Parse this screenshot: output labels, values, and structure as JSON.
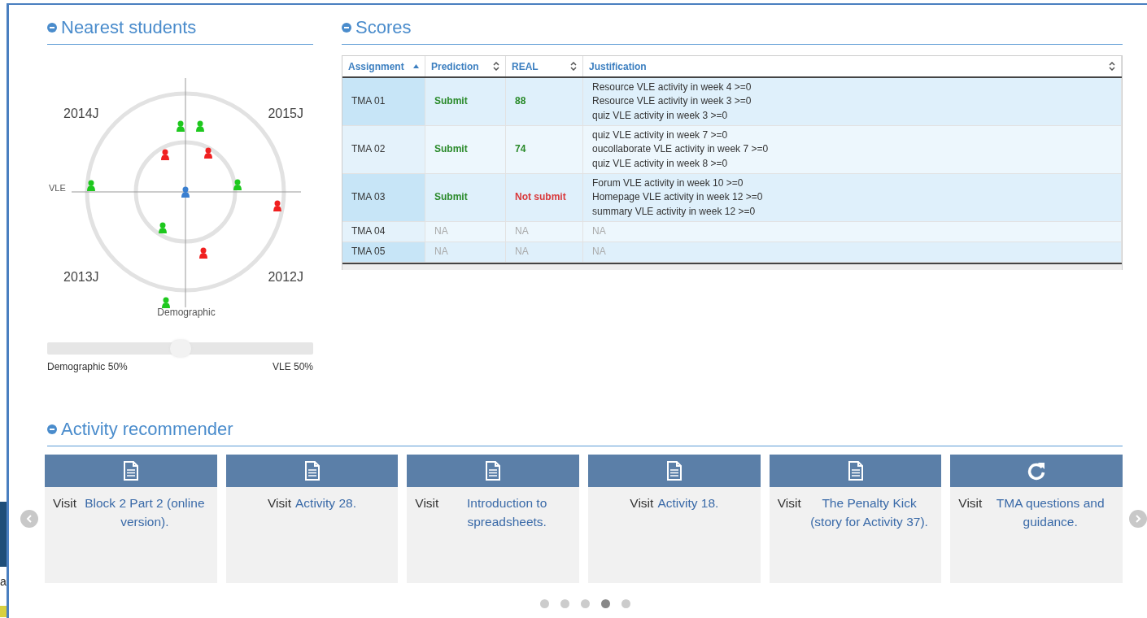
{
  "behind_window": {
    "text": "a"
  },
  "nearest_students": {
    "title": "Nearest students",
    "quadrants": [
      "2014J",
      "2015J",
      "2013J",
      "2012J"
    ],
    "students": [
      {
        "color": "#1ec81e"
      },
      {
        "color": "#1ec81e"
      },
      {
        "color": "#f02020"
      },
      {
        "color": "#f02020"
      },
      {
        "color": "#1ec81e"
      },
      {
        "color": "#1ec81e"
      },
      {
        "color": "#3a7fd0"
      },
      {
        "color": "#f02020"
      },
      {
        "color": "#1ec81e"
      },
      {
        "color": "#f02020"
      },
      {
        "color": "#1ec81e"
      }
    ],
    "x_axis_label": "VLE",
    "y_axis_label": "Demographic",
    "weight_slider": {
      "level": 0.5,
      "left_label": "Demographic 50%",
      "right_label": "VLE 50%"
    }
  },
  "scores": {
    "title": "Scores",
    "columns": [
      {
        "label": "Assignment",
        "kind": "sorted"
      },
      {
        "label": "Prediction",
        "kind": "sortable"
      },
      {
        "label": "REAL",
        "kind": "sortable"
      },
      {
        "label": "Justification",
        "kind": "sortable"
      }
    ],
    "rows": [
      {
        "assignment": "TMA 01",
        "prediction": {
          "text": "Submit",
          "kind": "positive"
        },
        "real": {
          "text": "88",
          "kind": "positive"
        },
        "justification": {
          "kind": "rules",
          "lines": [
            "Resource VLE activity in week 4 >=0",
            "Resource VLE activity in week 3 >=0",
            "quiz VLE activity in week 3 >=0"
          ]
        }
      },
      {
        "assignment": "TMA 02",
        "prediction": {
          "text": "Submit",
          "kind": "positive"
        },
        "real": {
          "text": "74",
          "kind": "positive"
        },
        "justification": {
          "kind": "rules",
          "lines": [
            "quiz VLE activity in week 7 >=0",
            "oucollaborate VLE activity in week 7 >=0",
            "quiz VLE activity in week 8 >=0"
          ]
        }
      },
      {
        "assignment": "TMA 03",
        "prediction": {
          "text": "Submit",
          "kind": "positive"
        },
        "real": {
          "text": "Not submit",
          "kind": "negative"
        },
        "justification": {
          "kind": "rules",
          "lines": [
            "Forum VLE activity in week 10 >=0",
            "Homepage VLE activity in week 12 >=0",
            "summary VLE activity in week 12 >=0"
          ]
        }
      },
      {
        "assignment": "TMA 04",
        "prediction": {
          "text": "NA",
          "kind": "na"
        },
        "real": {
          "text": "NA",
          "kind": "na"
        },
        "justification": {
          "kind": "na",
          "lines": [
            "NA"
          ]
        }
      },
      {
        "assignment": "TMA 05",
        "prediction": {
          "text": "NA",
          "kind": "na"
        },
        "real": {
          "text": "NA",
          "kind": "na"
        },
        "justification": {
          "kind": "na",
          "lines": [
            "NA"
          ]
        }
      }
    ]
  },
  "activity_recommender": {
    "title": "Activity recommender",
    "cards": [
      {
        "kind": "document",
        "prefix": "Visit",
        "link": "Block 2 Part 2 (online version)."
      },
      {
        "kind": "document",
        "prefix": "Visit",
        "link": "Activity 28."
      },
      {
        "kind": "document",
        "prefix": "Visit",
        "link": "Introduction to spreadsheets."
      },
      {
        "kind": "document",
        "prefix": "Visit",
        "link": "Activity 18."
      },
      {
        "kind": "document",
        "prefix": "Visit",
        "link": "The Penalty Kick (story for Activity 37)."
      },
      {
        "kind": "refresh",
        "prefix": "Visit",
        "link": "TMA questions and guidance."
      }
    ],
    "pages": [
      {
        "selected": false
      },
      {
        "selected": false
      },
      {
        "selected": false
      },
      {
        "selected": true
      },
      {
        "selected": false
      }
    ]
  }
}
